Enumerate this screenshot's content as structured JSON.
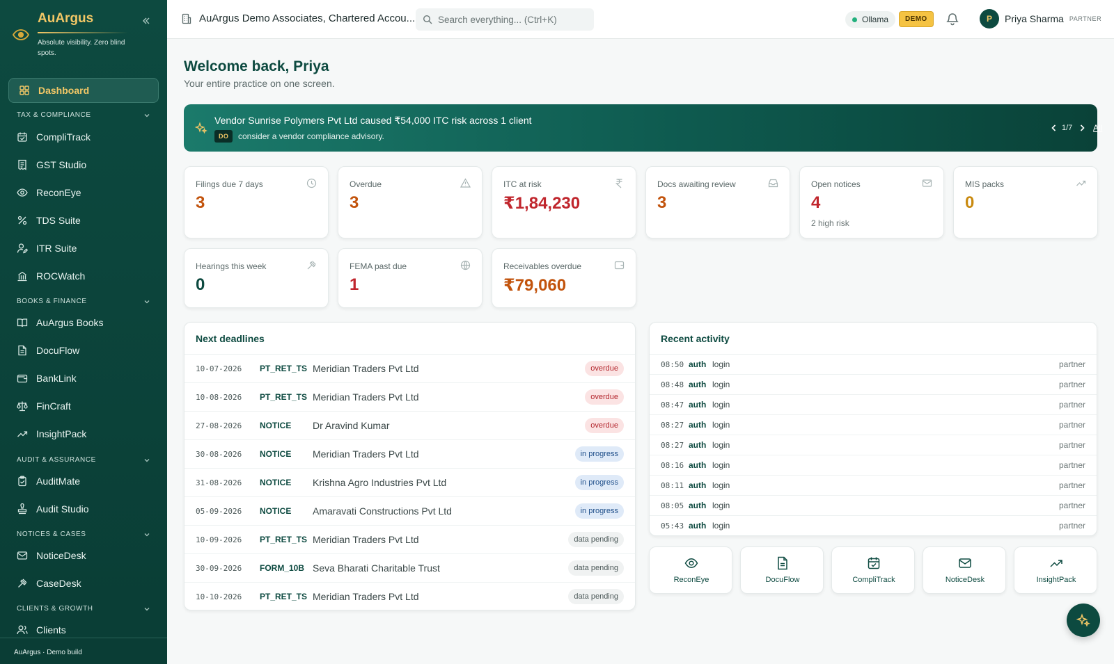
{
  "brand": {
    "name": "AuArgus",
    "tagline": "Absolute visibility. Zero blind spots."
  },
  "sidebar": {
    "active": {
      "label": "Dashboard",
      "icon": "dashboard-icon"
    },
    "sections": [
      {
        "title": "TAX & COMPLIANCE",
        "items": [
          {
            "label": "CompliTrack",
            "icon": "calendar-check-icon"
          },
          {
            "label": "GST Studio",
            "icon": "receipt-icon"
          },
          {
            "label": "ReconEye",
            "icon": "eye-icon"
          },
          {
            "label": "TDS Suite",
            "icon": "percent-icon"
          },
          {
            "label": "ITR Suite",
            "icon": "user-pen-icon"
          },
          {
            "label": "ROCWatch",
            "icon": "building-icon"
          }
        ]
      },
      {
        "title": "BOOKS & FINANCE",
        "items": [
          {
            "label": "AuArgus Books",
            "icon": "book-open-icon"
          },
          {
            "label": "DocuFlow",
            "icon": "file-text-icon"
          },
          {
            "label": "BankLink",
            "icon": "wallet-icon"
          },
          {
            "label": "FinCraft",
            "icon": "scale-icon"
          },
          {
            "label": "InsightPack",
            "icon": "trending-up-icon"
          }
        ]
      },
      {
        "title": "AUDIT & ASSURANCE",
        "items": [
          {
            "label": "AuditMate",
            "icon": "clipboard-check-icon"
          },
          {
            "label": "Audit Studio",
            "icon": "stamp-icon"
          }
        ]
      },
      {
        "title": "NOTICES & CASES",
        "items": [
          {
            "label": "NoticeDesk",
            "icon": "mail-icon"
          },
          {
            "label": "CaseDesk",
            "icon": "gavel-icon"
          }
        ]
      },
      {
        "title": "CLIENTS & GROWTH",
        "items": [
          {
            "label": "Clients",
            "icon": "users-icon"
          }
        ]
      }
    ],
    "footer": "AuArgus · Demo build"
  },
  "topbar": {
    "org": "AuArgus Demo Associates, Chartered Accou...",
    "search_placeholder": "Search everything... (Ctrl+K)",
    "ollama": "Ollama",
    "demo_badge": "DEMO",
    "user": {
      "initial": "P",
      "name": "Priya Sharma",
      "role": "PARTNER"
    }
  },
  "welcome": {
    "title": "Welcome back, Priya",
    "subtitle": "Your entire practice on one screen."
  },
  "banner": {
    "text": "Vendor Sunrise Polymers Pvt Ltd caused ₹54,000 ITC risk across 1 client",
    "tag": "DO",
    "advice": "consider a vendor compliance advisory.",
    "pager": "1/7",
    "all": "All"
  },
  "kpis": [
    {
      "label": "Filings due 7 days",
      "value": "3",
      "sub": "",
      "icon": "clock-icon",
      "color": "#c2530c"
    },
    {
      "label": "Overdue",
      "value": "3",
      "sub": "",
      "icon": "alert-triangle-icon",
      "color": "#c2530c"
    },
    {
      "label": "ITC at risk",
      "value": "₹1,84,230",
      "sub": "",
      "icon": "rupee-icon",
      "color": "#c0262d"
    },
    {
      "label": "Docs awaiting review",
      "value": "3",
      "sub": "",
      "icon": "inbox-icon",
      "color": "#c2530c"
    },
    {
      "label": "Open notices",
      "value": "4",
      "sub": "2 high risk",
      "icon": "mail-icon",
      "color": "#c0262d"
    },
    {
      "label": "MIS packs",
      "value": "0",
      "sub": "",
      "icon": "trending-up-icon",
      "color": "#c98a10"
    },
    {
      "label": "Hearings this week",
      "value": "0",
      "sub": "",
      "icon": "gavel-icon",
      "color": "#0d4a40"
    },
    {
      "label": "FEMA past due",
      "value": "1",
      "sub": "",
      "icon": "globe-icon",
      "color": "#c0262d"
    },
    {
      "label": "Receivables overdue",
      "value": "₹79,060",
      "sub": "",
      "icon": "wallet-icon",
      "color": "#c2530c"
    }
  ],
  "deadlines": {
    "title": "Next deadlines",
    "rows": [
      {
        "date": "10-07-2026",
        "form": "PT_RET_TS",
        "client": "Meridian Traders Pvt Ltd",
        "status": "overdue"
      },
      {
        "date": "10-08-2026",
        "form": "PT_RET_TS",
        "client": "Meridian Traders Pvt Ltd",
        "status": "overdue"
      },
      {
        "date": "27-08-2026",
        "form": "NOTICE",
        "client": "Dr Aravind Kumar",
        "status": "overdue"
      },
      {
        "date": "30-08-2026",
        "form": "NOTICE",
        "client": "Meridian Traders Pvt Ltd",
        "status": "in progress"
      },
      {
        "date": "31-08-2026",
        "form": "NOTICE",
        "client": "Krishna Agro Industries Pvt Ltd",
        "status": "in progress"
      },
      {
        "date": "05-09-2026",
        "form": "NOTICE",
        "client": "Amaravati Constructions Pvt Ltd",
        "status": "in progress"
      },
      {
        "date": "10-09-2026",
        "form": "PT_RET_TS",
        "client": "Meridian Traders Pvt Ltd",
        "status": "data pending"
      },
      {
        "date": "30-09-2026",
        "form": "FORM_10B",
        "client": "Seva Bharati Charitable Trust",
        "status": "data pending"
      },
      {
        "date": "10-10-2026",
        "form": "PT_RET_TS",
        "client": "Meridian Traders Pvt Ltd",
        "status": "data pending"
      }
    ]
  },
  "activity": {
    "title": "Recent activity",
    "rows": [
      {
        "time": "08:50",
        "module": "auth",
        "action": "login",
        "role": "partner"
      },
      {
        "time": "08:48",
        "module": "auth",
        "action": "login",
        "role": "partner"
      },
      {
        "time": "08:47",
        "module": "auth",
        "action": "login",
        "role": "partner"
      },
      {
        "time": "08:27",
        "module": "auth",
        "action": "login",
        "role": "partner"
      },
      {
        "time": "08:27",
        "module": "auth",
        "action": "login",
        "role": "partner"
      },
      {
        "time": "08:16",
        "module": "auth",
        "action": "login",
        "role": "partner"
      },
      {
        "time": "08:11",
        "module": "auth",
        "action": "login",
        "role": "partner"
      },
      {
        "time": "08:05",
        "module": "auth",
        "action": "login",
        "role": "partner"
      },
      {
        "time": "05:43",
        "module": "auth",
        "action": "login",
        "role": "partner"
      }
    ]
  },
  "quicklinks": [
    {
      "label": "ReconEye",
      "icon": "eye-icon"
    },
    {
      "label": "DocuFlow",
      "icon": "file-text-icon"
    },
    {
      "label": "CompliTrack",
      "icon": "calendar-check-icon"
    },
    {
      "label": "NoticeDesk",
      "icon": "mail-icon"
    },
    {
      "label": "InsightPack",
      "icon": "trending-up-icon"
    }
  ],
  "colors": {
    "sidebar": "#0d4a40",
    "accent_gold": "#f2c766",
    "danger": "#c0262d",
    "warning": "#c2530c"
  }
}
